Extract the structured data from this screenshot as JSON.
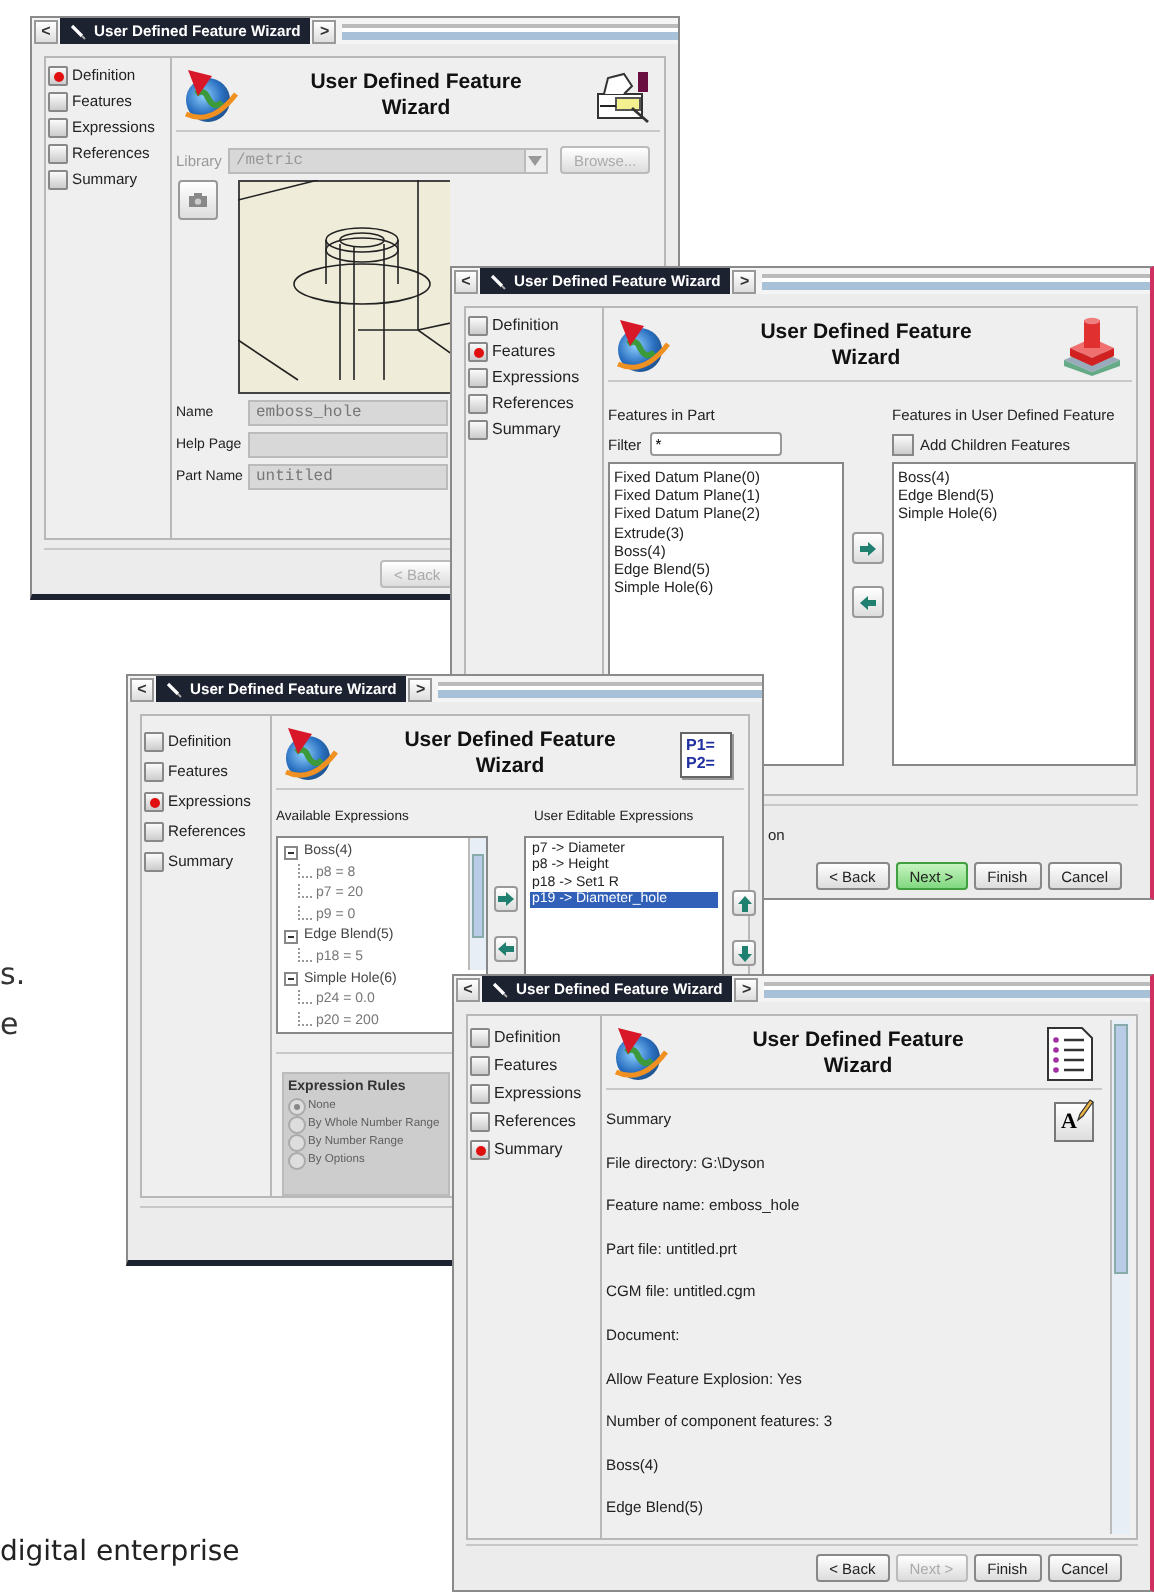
{
  "page_text": {
    "margin_fragments": [
      "s.",
      "e"
    ],
    "footer": "digital enterprise"
  },
  "windows": [
    {
      "kind": "definition",
      "title": "User Defined Feature Wizard",
      "nav_prev": "<",
      "nav_next": ">",
      "steps": [
        {
          "label": "Definition",
          "selected": true
        },
        {
          "label": "Features",
          "selected": false
        },
        {
          "label": "Expressions",
          "selected": false
        },
        {
          "label": "References",
          "selected": false
        },
        {
          "label": "Summary",
          "selected": false
        }
      ],
      "heading": [
        "User Defined Feature",
        "Wizard"
      ],
      "library": {
        "label": "Library",
        "value": "/metric",
        "disabled": true
      },
      "browse_button": {
        "label": "Browse...",
        "disabled": true
      },
      "fields": [
        {
          "label": "Name",
          "value": "emboss_hole",
          "disabled": true
        },
        {
          "label": "Help Page",
          "disabled": true
        },
        {
          "label": "Part Name",
          "value": "untitled",
          "disabled": true
        }
      ],
      "buttons": [
        {
          "label": "< Back",
          "disabled": true,
          "default": false
        }
      ]
    },
    {
      "kind": "features",
      "title": "User Defined Feature Wizard",
      "nav_prev": "<",
      "nav_next": ">",
      "steps": [
        {
          "label": "Definition",
          "selected": false
        },
        {
          "label": "Features",
          "selected": true
        },
        {
          "label": "Expressions",
          "selected": false
        },
        {
          "label": "References",
          "selected": false
        },
        {
          "label": "Summary",
          "selected": false
        }
      ],
      "heading": [
        "User Defined Feature",
        "Wizard"
      ],
      "left_label": "Features in Part",
      "filter": {
        "label": "Filter",
        "value": "*"
      },
      "part_features": [
        "Fixed Datum Plane(0)",
        "Fixed Datum Plane(1)",
        "Fixed Datum Plane(2)",
        "Extrude(3)",
        "Boss(4)",
        "Edge Blend(5)",
        "Simple Hole(6)"
      ],
      "right_label": "Features in User Defined Feature",
      "add_children": {
        "label": "Add Children Features",
        "checked": false
      },
      "udf_features": [
        "Boss(4)",
        "Edge Blend(5)",
        "Simple Hole(6)"
      ],
      "partial_label": "on",
      "buttons": [
        {
          "label": "< Back",
          "disabled": false,
          "default": false
        },
        {
          "label": "Next >",
          "disabled": false,
          "default": true
        },
        {
          "label": "Finish",
          "disabled": false,
          "default": false
        },
        {
          "label": "Cancel",
          "disabled": false,
          "default": false
        }
      ]
    },
    {
      "kind": "expressions",
      "title": "User Defined Feature Wizard",
      "nav_prev": "<",
      "nav_next": ">",
      "steps": [
        {
          "label": "Definition",
          "selected": false
        },
        {
          "label": "Features",
          "selected": false
        },
        {
          "label": "Expressions",
          "selected": true
        },
        {
          "label": "References",
          "selected": false
        },
        {
          "label": "Summary",
          "selected": false
        }
      ],
      "heading": [
        "User Defined Feature",
        "Wizard"
      ],
      "badge": [
        "P1=",
        "P2="
      ],
      "available_label": "Available Expressions",
      "tree": [
        {
          "label": "Boss(4)",
          "expanded": true,
          "children": [
            {
              "label": "p8 = 8"
            },
            {
              "label": "p7 = 20"
            },
            {
              "label": "p9 = 0"
            }
          ]
        },
        {
          "label": "Edge Blend(5)",
          "expanded": true,
          "children": [
            {
              "label": "p18 = 5"
            }
          ]
        },
        {
          "label": "Simple Hole(6)",
          "expanded": true,
          "children": [
            {
              "label": "p24 = 0.0"
            },
            {
              "label": "p20 = 200"
            }
          ]
        }
      ],
      "editable_label": "User Editable Expressions",
      "editable": [
        {
          "label": "p7 -> Diameter",
          "selected": false
        },
        {
          "label": "p8 -> Height",
          "selected": false
        },
        {
          "label": "p18 -> Set1 R",
          "selected": false
        },
        {
          "label": "p19 -> Diameter_hole",
          "selected": true
        }
      ],
      "rules": {
        "title": "Expression Rules",
        "disabled": true,
        "options": [
          {
            "label": "None",
            "selected": true
          },
          {
            "label": "By Whole Number Range",
            "selected": false
          },
          {
            "label": "By Number Range",
            "selected": false
          },
          {
            "label": "By Options",
            "selected": false
          }
        ]
      }
    },
    {
      "kind": "summary",
      "title": "User Defined Feature Wizard",
      "nav_prev": "<",
      "nav_next": ">",
      "steps": [
        {
          "label": "Definition",
          "selected": false
        },
        {
          "label": "Features",
          "selected": false
        },
        {
          "label": "Expressions",
          "selected": false
        },
        {
          "label": "References",
          "selected": false
        },
        {
          "label": "Summary",
          "selected": true
        }
      ],
      "heading": [
        "User Defined Feature",
        "Wizard"
      ],
      "edit_glyph": "A",
      "summary_lines": [
        "Summary",
        "File directory: G:\\Dyson",
        "Feature name: emboss_hole",
        "Part file: untitled.prt",
        "CGM file: untitled.cgm",
        "Document:",
        "Allow Feature Explosion: Yes",
        "Number of component features: 3",
        "Boss(4)",
        "Edge Blend(5)"
      ],
      "buttons": [
        {
          "label": "< Back",
          "disabled": false,
          "default": false
        },
        {
          "label": "Next >",
          "disabled": true,
          "default": false
        },
        {
          "label": "Finish",
          "disabled": false,
          "default": false
        },
        {
          "label": "Cancel",
          "disabled": false,
          "default": false
        }
      ]
    }
  ]
}
